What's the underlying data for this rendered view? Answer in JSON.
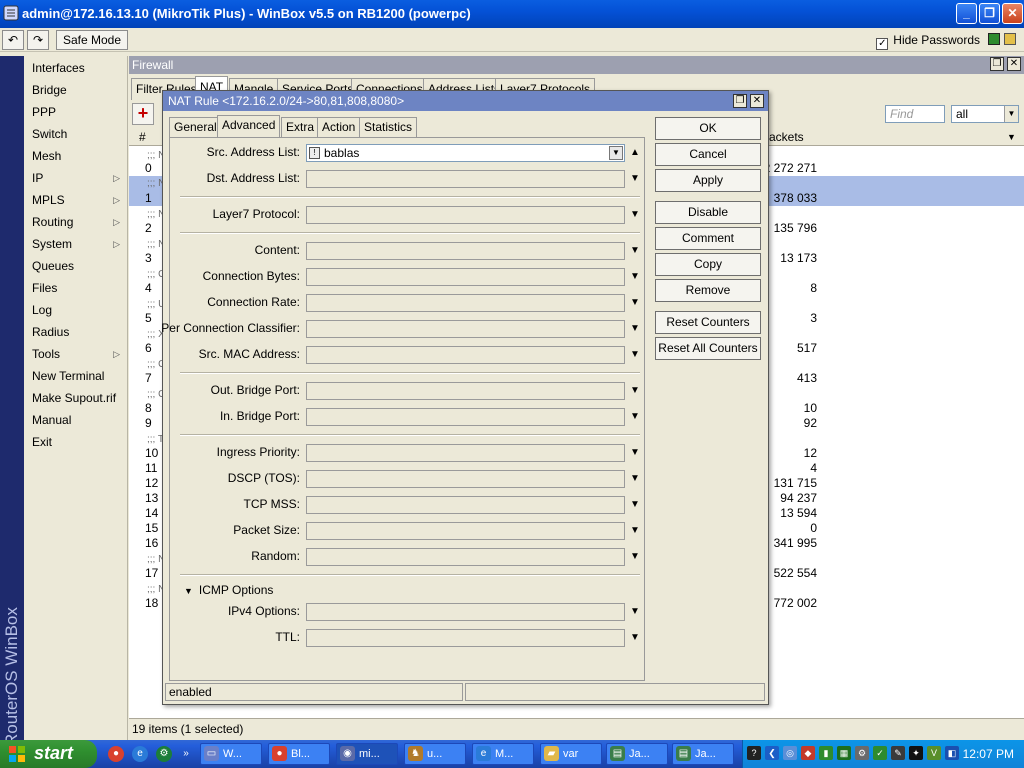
{
  "window": {
    "title": "admin@172.16.13.10 (MikroTik Plus) - WinBox v5.5 on RB1200 (powerpc)"
  },
  "toolbar": {
    "undo_icon": "undo-icon",
    "redo_icon": "redo-icon",
    "safe_mode": "Safe Mode",
    "hide_passwords": "Hide Passwords",
    "hide_passwords_checked": true
  },
  "brand": "RouterOS WinBox",
  "sidebar": {
    "items": [
      {
        "label": "Interfaces",
        "submenu": false
      },
      {
        "label": "Bridge",
        "submenu": false
      },
      {
        "label": "PPP",
        "submenu": false
      },
      {
        "label": "Switch",
        "submenu": false
      },
      {
        "label": "Mesh",
        "submenu": false
      },
      {
        "label": "IP",
        "submenu": true
      },
      {
        "label": "MPLS",
        "submenu": true
      },
      {
        "label": "Routing",
        "submenu": true
      },
      {
        "label": "System",
        "submenu": true
      },
      {
        "label": "Queues",
        "submenu": false
      },
      {
        "label": "Files",
        "submenu": false
      },
      {
        "label": "Log",
        "submenu": false
      },
      {
        "label": "Radius",
        "submenu": false
      },
      {
        "label": "Tools",
        "submenu": true
      },
      {
        "label": "New Terminal",
        "submenu": false
      },
      {
        "label": "Make Supout.rif",
        "submenu": false
      },
      {
        "label": "Manual",
        "submenu": false
      },
      {
        "label": "Exit",
        "submenu": false
      }
    ]
  },
  "firewall": {
    "title": "Firewall",
    "tabs": [
      "Filter Rules",
      "NAT",
      "Mangle",
      "Service Ports",
      "Connections",
      "Address Lists",
      "Layer7 Protocols"
    ],
    "active_tab": "NAT",
    "find_placeholder": "Find",
    "filter_value": "all",
    "columns": {
      "num": "#",
      "packets": "Packets"
    },
    "rows": [
      {
        "comment": ";;; N",
        "num": "0",
        "packets": "2 272 271"
      },
      {
        "comment": ";;; N",
        "num": "1",
        "packets": "378 033",
        "selected": true
      },
      {
        "comment": ";;; N",
        "num": "2",
        "packets": "135 796"
      },
      {
        "comment": ";;; N",
        "num": "3",
        "packets": "13 173"
      },
      {
        "comment": ";;; O",
        "num": "4",
        "packets": "8"
      },
      {
        "comment": ";;; U",
        "num": "5",
        "packets": "3"
      },
      {
        "comment": ";;; X",
        "num": "6",
        "packets": "517"
      },
      {
        "comment": ";;; O",
        "num": "7",
        "packets": "413"
      },
      {
        "comment": ";;; O",
        "num": "8",
        "packets": "10"
      },
      {
        "comment": "",
        "num": "9",
        "packets": "92"
      },
      {
        "comment": ";;; T",
        "num": "10",
        "packets": "12"
      },
      {
        "comment": "",
        "num": "11",
        "packets": "4"
      },
      {
        "comment": "",
        "num": "12",
        "packets": "131 715"
      },
      {
        "comment": "",
        "num": "13",
        "packets": "94 237"
      },
      {
        "comment": "",
        "num": "14",
        "packets": "13 594"
      },
      {
        "comment": "",
        "num": "15",
        "packets": "0"
      },
      {
        "comment": "",
        "num": "16",
        "packets": "341 995"
      },
      {
        "comment": ";;; N",
        "num": "17",
        "packets": "522 554"
      },
      {
        "comment": ";;; N",
        "num": "18",
        "packets": "772 002"
      }
    ],
    "status": "19 items (1 selected)"
  },
  "dialog": {
    "title": "NAT Rule <172.16.2.0/24->80,81,808,8080>",
    "tabs": [
      "General",
      "Advanced",
      "Extra",
      "Action",
      "Statistics"
    ],
    "active_tab": "Advanced",
    "fields": {
      "src_address_list": {
        "label": "Src. Address List:",
        "value": "bablas"
      },
      "dst_address_list": {
        "label": "Dst. Address List:",
        "value": ""
      },
      "layer7_protocol": {
        "label": "Layer7 Protocol:",
        "value": ""
      },
      "content": {
        "label": "Content:",
        "value": ""
      },
      "connection_bytes": {
        "label": "Connection Bytes:",
        "value": ""
      },
      "connection_rate": {
        "label": "Connection Rate:",
        "value": ""
      },
      "per_connection_classifier": {
        "label": "Per Connection Classifier:",
        "value": ""
      },
      "src_mac_address": {
        "label": "Src. MAC Address:",
        "value": ""
      },
      "out_bridge_port": {
        "label": "Out. Bridge Port:",
        "value": ""
      },
      "in_bridge_port": {
        "label": "In. Bridge Port:",
        "value": ""
      },
      "ingress_priority": {
        "label": "Ingress Priority:",
        "value": ""
      },
      "dscp": {
        "label": "DSCP (TOS):",
        "value": ""
      },
      "tcp_mss": {
        "label": "TCP MSS:",
        "value": ""
      },
      "packet_size": {
        "label": "Packet Size:",
        "value": ""
      },
      "random": {
        "label": "Random:",
        "value": ""
      },
      "ipv4_options": {
        "label": "IPv4 Options:",
        "value": ""
      },
      "ttl": {
        "label": "TTL:",
        "value": ""
      }
    },
    "icmp_section": "ICMP Options",
    "buttons": {
      "ok": "OK",
      "cancel": "Cancel",
      "apply": "Apply",
      "disable": "Disable",
      "comment": "Comment",
      "copy": "Copy",
      "remove": "Remove",
      "reset_counters": "Reset Counters",
      "reset_all_counters": "Reset All Counters"
    },
    "status": "enabled"
  },
  "taskbar": {
    "start": "start",
    "tasks": [
      {
        "label": "W...",
        "icon": "window-icon"
      },
      {
        "label": "Bl...",
        "icon": "chrome-icon"
      },
      {
        "label": "mi...",
        "icon": "winbox-icon"
      },
      {
        "label": "u...",
        "icon": "app-icon"
      },
      {
        "label": "M...",
        "icon": "ie-icon"
      },
      {
        "label": "var",
        "icon": "folder-icon"
      },
      {
        "label": "Ja...",
        "icon": "editor-icon"
      },
      {
        "label": "Ja...",
        "icon": "editor-icon"
      }
    ],
    "clock": "12:07 PM"
  },
  "colors": {
    "xp_blue": "#0451d6",
    "selection": "#a9bce6",
    "dialog_title": "#6d84c3",
    "winbox_stripe": "#1e2a6d"
  }
}
